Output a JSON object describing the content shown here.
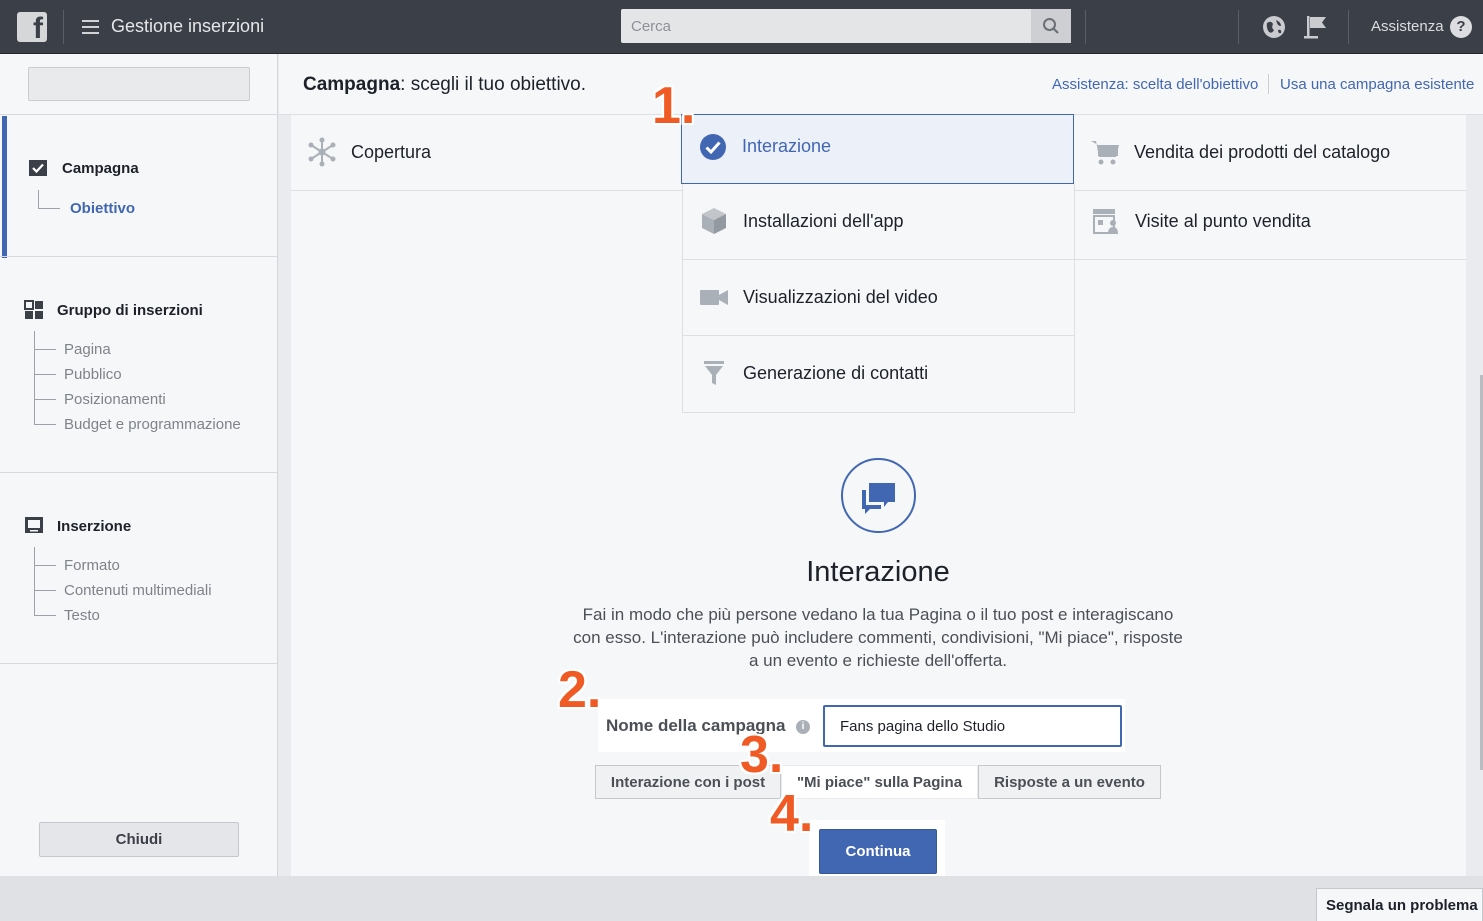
{
  "topbar": {
    "app_title": "Gestione inserzioni",
    "search_placeholder": "Cerca",
    "help_label": "Assistenza",
    "help_icon": "?"
  },
  "sidebar": {
    "sections": [
      {
        "title": "Campagna",
        "items": [
          "Obiettivo"
        ]
      },
      {
        "title": "Gruppo di inserzioni",
        "items": [
          "Pagina",
          "Pubblico",
          "Posizionamenti",
          "Budget e programmazione"
        ]
      },
      {
        "title": "Inserzione",
        "items": [
          "Formato",
          "Contenuti multimediali",
          "Testo"
        ]
      }
    ],
    "close_label": "Chiudi"
  },
  "header": {
    "title_bold": "Campagna",
    "title_rest": ": scegli il tuo obiettivo.",
    "link_help": "Assistenza: scelta dell'obiettivo",
    "link_existing": "Usa una campagna esistente"
  },
  "objectives": {
    "copertura": "Copertura",
    "interazione": "Interazione",
    "vendita": "Vendita dei prodotti del catalogo",
    "installazioni": "Installazioni dell'app",
    "visite": "Visite al punto vendita",
    "video": "Visualizzazioni del video",
    "contatti": "Generazione di contatti"
  },
  "detail": {
    "title": "Interazione",
    "description": "Fai in modo che più persone vedano la tua Pagina o il tuo post e interagiscano con esso. L'interazione può includere commenti, condivisioni, \"Mi piace\", risposte a un evento e richieste dell'offerta.",
    "name_label": "Nome della campagna",
    "name_value": "Fans pagina dello Studio",
    "options": [
      "Interazione con i post",
      "\"Mi piace\" sulla Pagina",
      "Risposte a un evento"
    ],
    "selected_option": "\"Mi piace\" sulla Pagina",
    "continue_label": "Continua"
  },
  "steps": [
    "1.",
    "2.",
    "3.",
    "4."
  ],
  "footer": {
    "report_label": "Segnala un problema"
  },
  "colors": {
    "accent": "#4267b2",
    "topbar": "#3b3f47",
    "step": "#f05a24"
  },
  "icons": [
    "facebook-logo-icon",
    "menu-icon",
    "search-icon",
    "globe-icon",
    "flag-icon",
    "help-icon",
    "checkbox-icon",
    "grid-icon",
    "monitor-icon",
    "reach-icon",
    "check-circle-icon",
    "cart-icon",
    "cube-icon",
    "store-icon",
    "video-camera-icon",
    "funnel-icon",
    "chat-bubbles-icon",
    "info-icon"
  ]
}
